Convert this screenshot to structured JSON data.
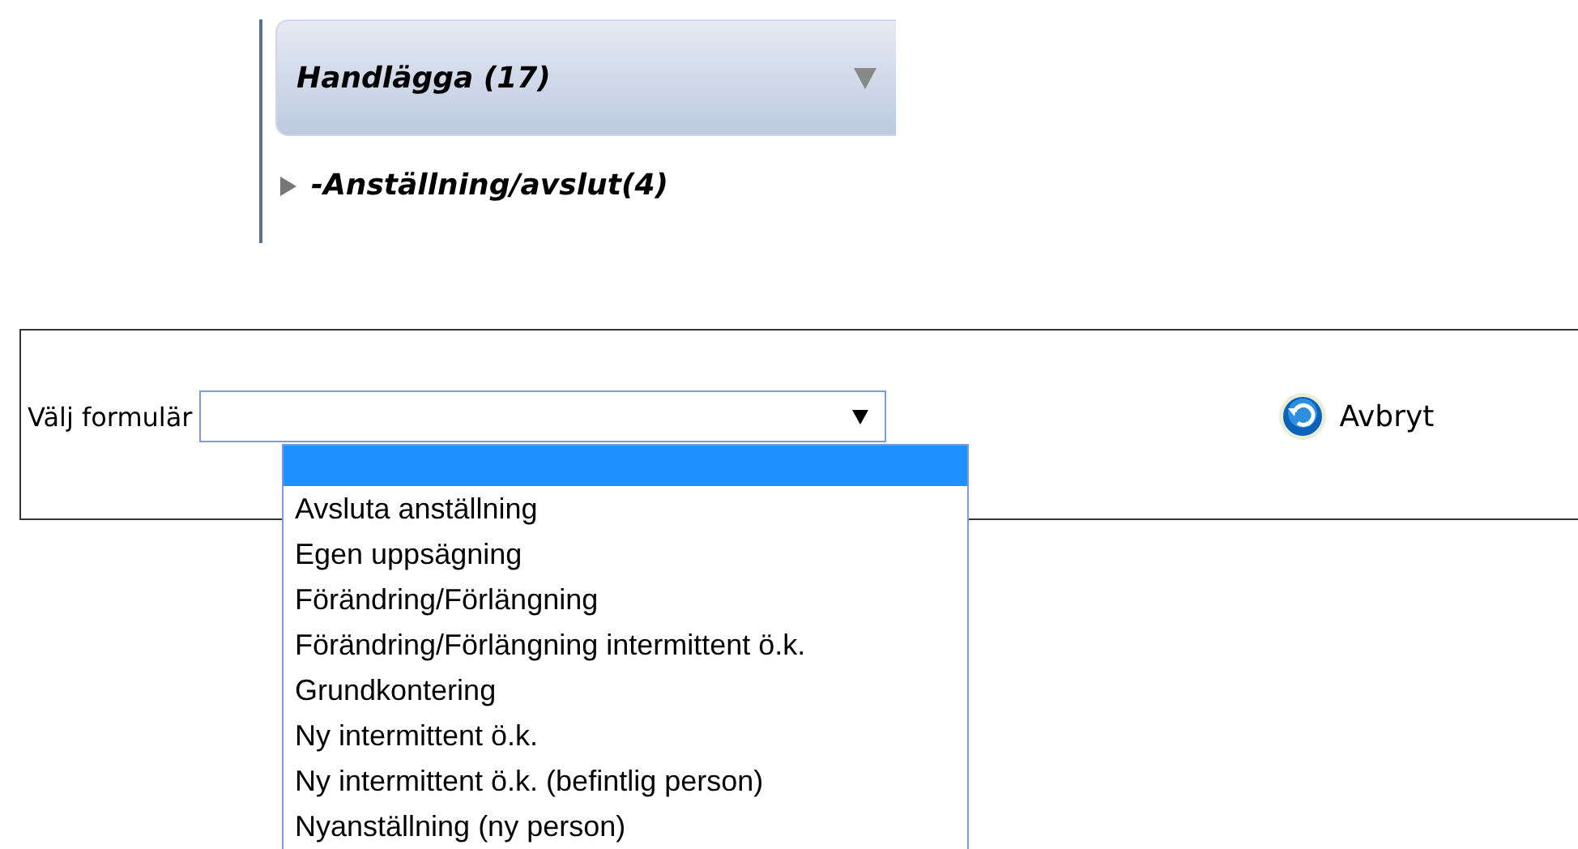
{
  "panel": {
    "title": "Handlägga (17)"
  },
  "tree": [
    {
      "label": "-Anställning/avslut(4)",
      "expanded": false
    }
  ],
  "form": {
    "label": "Välj formulär",
    "dropdown_open": true,
    "options": [
      {
        "selected": true
      },
      {
        "label": "Avsluta anställning",
        "selected": false
      },
      {
        "label": "Egen uppsägning",
        "selected": false
      },
      {
        "label": "Förändring/Förlängning",
        "selected": false
      },
      {
        "label": "Förändring/Förlängning intermittent ö.k.",
        "selected": false
      },
      {
        "label": "Grundkontering",
        "selected": false
      },
      {
        "label": "Ny intermittent ö.k.",
        "selected": false
      },
      {
        "label": "Ny intermittent ö.k. (befintlig person)",
        "selected": false
      },
      {
        "label": "Nyanställning (ny person)",
        "selected": false
      }
    ],
    "cancel_button": "Avbryt"
  }
}
